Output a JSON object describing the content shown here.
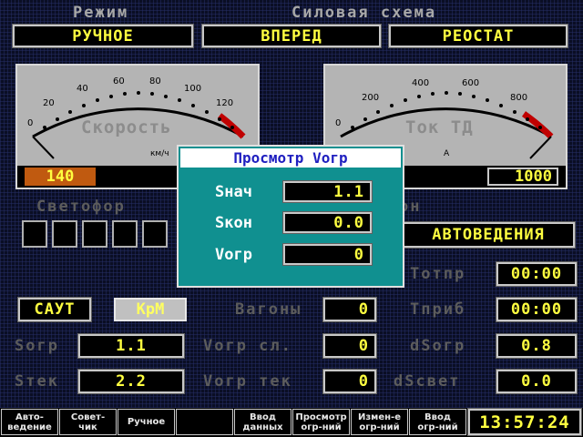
{
  "header": {
    "mode_label": "Режим",
    "power_label": "Силовая схема"
  },
  "top_boxes": {
    "mode": "РУЧНОЕ",
    "direction": "ВПЕРЕД",
    "circuit": "РЕОСТАТ"
  },
  "gauge_speed": {
    "label": "Скорость",
    "unit": "км/ч",
    "ticks": [
      "0",
      "20",
      "40",
      "60",
      "80",
      "100",
      "120"
    ],
    "value": "140"
  },
  "gauge_current": {
    "label": "Ток ТД",
    "unit": "А",
    "ticks": [
      "0",
      "200",
      "400",
      "600",
      "800"
    ],
    "value": "1000"
  },
  "signal": {
    "label": "Светофор",
    "lights": 5
  },
  "mode_fragment": {
    "label": "он",
    "value": "АВТОВЕДЕНИЯ"
  },
  "saut_button": "САУТ",
  "krm_button": "КрМ",
  "fields": {
    "s_ogr": {
      "label": "Sогр",
      "value": "1.1"
    },
    "s_tek": {
      "label": "Sтек",
      "value": "2.2"
    },
    "vagony": {
      "label": "Вагоны",
      "value": "0"
    },
    "v_ogr_sl": {
      "label": "Vогр сл.",
      "value": "0"
    },
    "v_ogr_tek": {
      "label": "Vогр тек",
      "value": "0"
    },
    "t_otpr": {
      "label": "Тотпр",
      "value": "00:00"
    },
    "t_prib": {
      "label": "Тприб",
      "value": "00:00"
    },
    "ds_ogr": {
      "label": "dSогр",
      "value": "0.8"
    },
    "ds_svet": {
      "label": "dSсвет",
      "value": "0.0"
    }
  },
  "dialog": {
    "title": "Просмотр Vогр",
    "rows": [
      {
        "label": "Sнач",
        "value": "1.1"
      },
      {
        "label": "Sкон",
        "value": "0.0"
      },
      {
        "label": "Vогр",
        "value": "0"
      }
    ]
  },
  "fkeys": [
    "Авто-\nведение",
    "Совет-\nчик",
    "Ручное",
    "",
    "Ввод\nданных",
    "Просмотр\nогр-ний",
    "Измен-е\nогр-ний",
    "Ввод\nогр-ний"
  ],
  "clock": "13:57:24",
  "colors": {
    "value_text": "#ffff40",
    "speed_value_bg": "#c05a10",
    "redline": "#c00000",
    "dialog_bg": "#109090"
  }
}
